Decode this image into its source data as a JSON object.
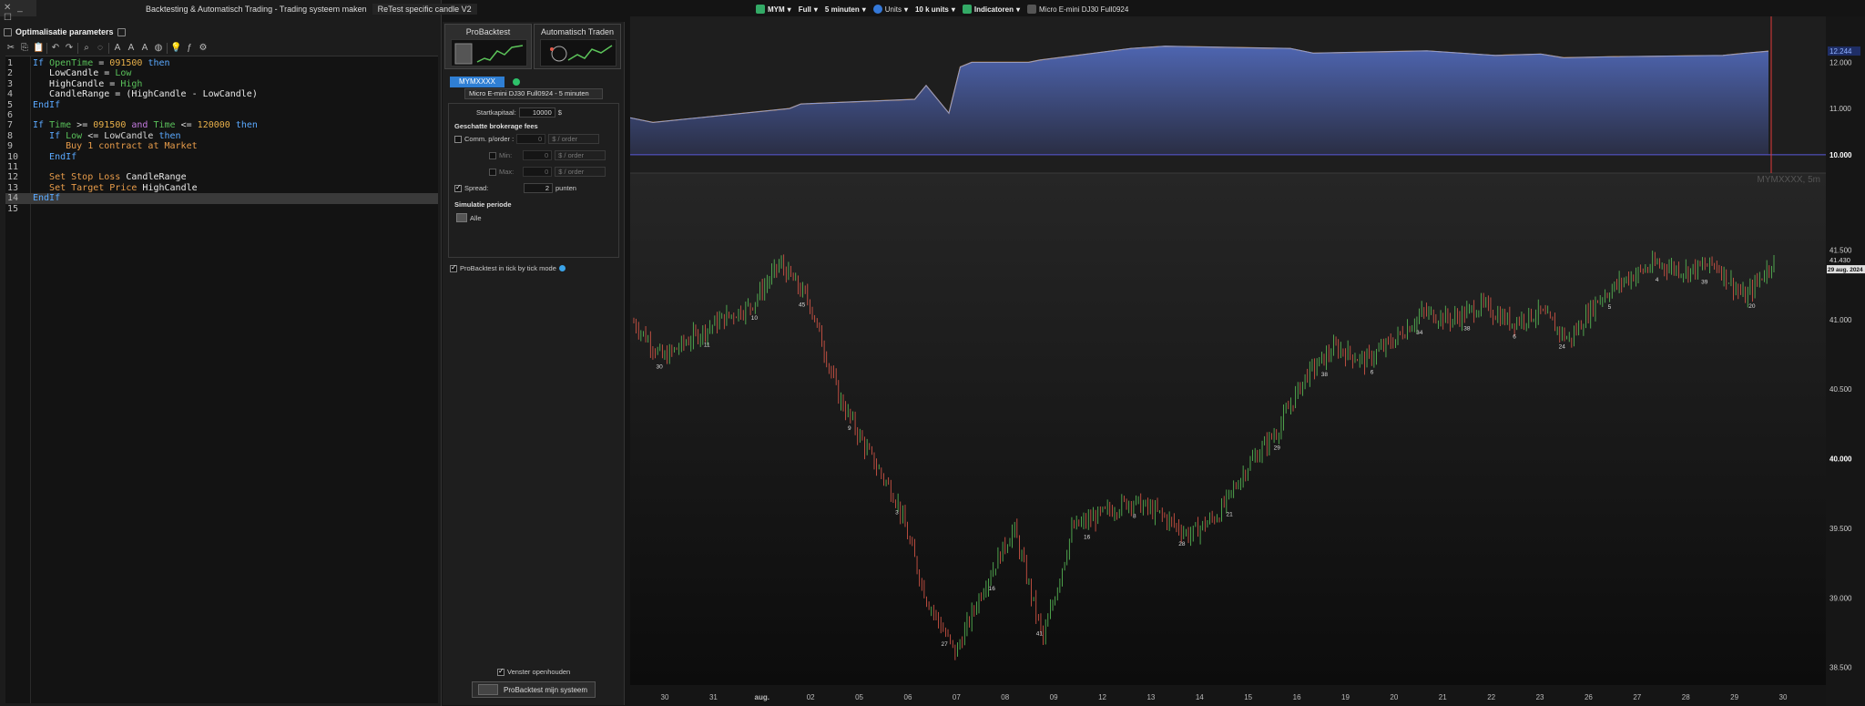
{
  "window": {
    "controls": "✕ _ ☐",
    "tab1": "Backtesting & Automatisch Trading - Trading systeem maken",
    "tab2": "ReTest specific candle V2"
  },
  "editor": {
    "panel_title": "Optimalisatie parameters",
    "lines": [
      {
        "n": "1",
        "parts": [
          [
            "kw",
            "If "
          ],
          [
            "fn",
            "OpenTime"
          ],
          [
            "op",
            " = "
          ],
          [
            "num-lit",
            "091500"
          ],
          [
            "kw",
            " then"
          ]
        ]
      },
      {
        "n": "2",
        "parts": [
          [
            "var",
            "   LowCandle = "
          ],
          [
            "fn",
            "Low"
          ]
        ]
      },
      {
        "n": "3",
        "parts": [
          [
            "var",
            "   HighCandle = "
          ],
          [
            "fn",
            "High"
          ]
        ]
      },
      {
        "n": "4",
        "parts": [
          [
            "var",
            "   CandleRange = (HighCandle - LowCandle)"
          ]
        ]
      },
      {
        "n": "5",
        "parts": [
          [
            "kw",
            "EndIf"
          ]
        ]
      },
      {
        "n": "6",
        "parts": []
      },
      {
        "n": "7",
        "parts": [
          [
            "kw",
            "If "
          ],
          [
            "fn",
            "Time"
          ],
          [
            "op",
            " >= "
          ],
          [
            "num-lit",
            "091500"
          ],
          [
            "pur",
            " and "
          ],
          [
            "fn",
            "Time"
          ],
          [
            "op",
            " <= "
          ],
          [
            "num-lit",
            "120000"
          ],
          [
            "kw",
            " then"
          ]
        ]
      },
      {
        "n": "8",
        "parts": [
          [
            "kw",
            "   If "
          ],
          [
            "fn",
            "Low"
          ],
          [
            "op",
            " <= LowCandle "
          ],
          [
            "kw",
            "then"
          ]
        ]
      },
      {
        "n": "9",
        "parts": [
          [
            "act",
            "      Buy 1 contract at Market"
          ]
        ]
      },
      {
        "n": "10",
        "parts": [
          [
            "kw",
            "   EndIf"
          ]
        ]
      },
      {
        "n": "11",
        "parts": []
      },
      {
        "n": "12",
        "parts": [
          [
            "act",
            "   Set Stop Loss "
          ],
          [
            "var",
            "CandleRange"
          ]
        ]
      },
      {
        "n": "13",
        "parts": [
          [
            "act",
            "   Set Target Price "
          ],
          [
            "var",
            "HighCandle"
          ]
        ]
      },
      {
        "n": "14",
        "parts": [
          [
            "kw",
            "EndIf"
          ]
        ]
      },
      {
        "n": "15",
        "parts": []
      }
    ]
  },
  "probacktest": {
    "tab_backtest": "ProBacktest",
    "tab_auto": "Automatisch Traden",
    "system_name": "MYMXXXX",
    "instrument": "Micro E-mini DJ30 Full0924 - 5 minuten",
    "start_label": "Startkapitaal:",
    "start_value": "10000",
    "start_unit": "$",
    "fees_header": "Geschatte brokerage fees",
    "comm_label": "Comm. p/order :",
    "comm_value": "0",
    "comm_unit": "$ / order",
    "min_label": "Min:",
    "min_value": "0",
    "min_unit": "$ / order",
    "max_label": "Max:",
    "max_value": "0",
    "max_unit": "$ / order",
    "spread_label": "Spread:",
    "spread_value": "2",
    "spread_unit": "punten",
    "sim_header": "Simulatie periode",
    "sim_value": "Alle",
    "tick_mode": "ProBacktest in tick by tick mode",
    "keep_window": "Venster openhouden",
    "run_button": "ProBacktest mijn systeem"
  },
  "chart_toolbar": {
    "symbol": "MYM",
    "range": "Full",
    "interval": "5 minuten",
    "units": "Units",
    "units_value": "10 k units",
    "indicators": "Indicatoren",
    "instrument": "Micro E-mini DJ30 Full0924"
  },
  "chart_data": [
    {
      "type": "area",
      "title": "",
      "y_ticks": [
        "12.000",
        "11.000",
        "10.000"
      ],
      "last_value_label": "12.244",
      "baseline": 10000,
      "ylim": [
        9800,
        12600
      ],
      "x": [
        0,
        0.02,
        0.14,
        0.15,
        0.25,
        0.26,
        0.28,
        0.29,
        0.3,
        0.35,
        0.36,
        0.44,
        0.47,
        0.58,
        0.6,
        0.7,
        0.76,
        0.8,
        0.82,
        0.86,
        0.96,
        0.98,
        1.0
      ],
      "values": [
        10800,
        10700,
        11000,
        11100,
        11200,
        11500,
        10900,
        11900,
        12000,
        12000,
        12050,
        12300,
        12350,
        12300,
        12200,
        12250,
        12150,
        12180,
        12100,
        12120,
        12150,
        12200,
        12244
      ],
      "colors": {
        "fill_top": "#4e65b0",
        "fill_bottom": "#2a2e44",
        "line": "#7c9ae8",
        "drawdown": "#e89a3a"
      }
    },
    {
      "type": "line",
      "title": "MYMXXXX, 5m",
      "y_ticks": [
        "41.500",
        "41.000",
        "40.500",
        "40.000",
        "39.500",
        "39.000",
        "38.500"
      ],
      "last_price_label": "41.430",
      "last_date_label": "29 aug. 2024",
      "ylim": [
        38400,
        42000
      ],
      "x_labels": [
        "30",
        "31",
        "aug.",
        "02",
        "05",
        "06",
        "07",
        "08",
        "09",
        "12",
        "13",
        "14",
        "15",
        "16",
        "19",
        "20",
        "21",
        "22",
        "23",
        "26",
        "27",
        "28",
        "29",
        "30"
      ],
      "closes": [
        40980,
        40720,
        40870,
        41000,
        41100,
        41400,
        41130,
        40450,
        40050,
        39700,
        39000,
        38600,
        39100,
        39500,
        38700,
        39500,
        39600,
        39700,
        39600,
        39450,
        39600,
        39950,
        40200,
        40600,
        40800,
        40700,
        40850,
        41050,
        41000,
        41100,
        40980,
        41050,
        40850,
        41150,
        41300,
        41400,
        41350,
        41400,
        41150,
        41430
      ],
      "trade_markers": [
        "30",
        "11",
        "10",
        "45",
        "9",
        "3",
        "27",
        "16",
        "41",
        "16",
        "8",
        "28",
        "21",
        "29",
        "38",
        "6",
        "34",
        "38",
        "6",
        "24",
        "5",
        "4",
        "39",
        "20"
      ],
      "colors": {
        "up": "#5cc45a",
        "down": "#e25a4a",
        "cursor": "#e23a3a"
      }
    }
  ]
}
